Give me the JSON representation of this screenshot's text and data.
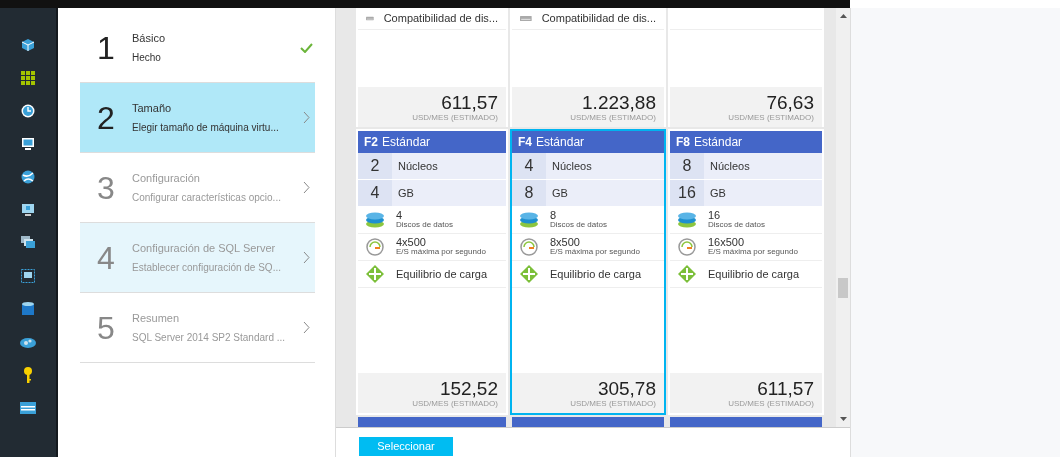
{
  "steps": [
    {
      "number": "1",
      "title": "Básico",
      "subtitle": "Hecho",
      "kind": "done",
      "selected": false,
      "disabled": false
    },
    {
      "number": "2",
      "title": "Tamaño",
      "subtitle": "Elegir tamaño de máquina virtu...",
      "kind": "pending",
      "selected": true,
      "disabled": false
    },
    {
      "number": "3",
      "title": "Configuración",
      "subtitle": "Configurar características opcio...",
      "kind": "pending",
      "selected": false,
      "disabled": true
    },
    {
      "number": "4",
      "title": "Configuración de SQL Server",
      "subtitle": "Establecer configuración de SQ...",
      "kind": "hovered",
      "selected": false,
      "disabled": true
    },
    {
      "number": "5",
      "title": "Resumen",
      "subtitle": "SQL Server 2014 SP2 Standard ...",
      "kind": "pending",
      "selected": false,
      "disabled": true
    }
  ],
  "top_row": [
    {
      "feature": "Compatibilidad de dis...",
      "price": "611,57",
      "price_unit": "USD/MES (ESTIMADO)"
    },
    {
      "feature": "Compatibilidad de dis...",
      "price": "1.223,88",
      "price_unit": "USD/MES (ESTIMADO)"
    },
    {
      "price": "76,63",
      "price_unit": "USD/MES (ESTIMADO)"
    }
  ],
  "cards": [
    {
      "tier": "F2",
      "name": "Estándar",
      "selected": false,
      "cores": "2",
      "cores_label": "Núcleos",
      "memory": "4",
      "memory_label": "GB",
      "features": [
        {
          "kind": "disks",
          "value": "4",
          "label": "Discos de datos"
        },
        {
          "kind": "iops",
          "value": "4x500",
          "label": "E/S máxima por segundo"
        },
        {
          "kind": "load_balancer",
          "label": "Equilibrio de carga"
        }
      ],
      "price": "152,52",
      "price_unit": "USD/MES (ESTIMADO)"
    },
    {
      "tier": "F4",
      "name": "Estándar",
      "selected": true,
      "cores": "4",
      "cores_label": "Núcleos",
      "memory": "8",
      "memory_label": "GB",
      "features": [
        {
          "kind": "disks",
          "value": "8",
          "label": "Discos de datos"
        },
        {
          "kind": "iops",
          "value": "8x500",
          "label": "E/S máxima por segundo"
        },
        {
          "kind": "load_balancer",
          "label": "Equilibrio de carga"
        }
      ],
      "price": "305,78",
      "price_unit": "USD/MES (ESTIMADO)"
    },
    {
      "tier": "F8",
      "name": "Estándar",
      "selected": false,
      "cores": "8",
      "cores_label": "Núcleos",
      "memory": "16",
      "memory_label": "GB",
      "features": [
        {
          "kind": "disks",
          "value": "16",
          "label": "Discos de datos"
        },
        {
          "kind": "iops",
          "value": "16x500",
          "label": "E/S máxima por segundo"
        },
        {
          "kind": "load_balancer",
          "label": "Equilibrio de carga"
        }
      ],
      "price": "611,57",
      "price_unit": "USD/MES (ESTIMADO)"
    }
  ],
  "footer": {
    "button": "Seleccionar"
  }
}
